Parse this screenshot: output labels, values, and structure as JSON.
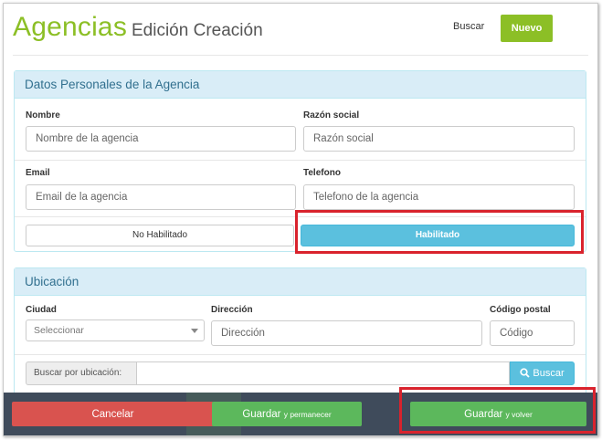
{
  "header": {
    "title": "Agencias",
    "subtitle": "Edición Creación",
    "buscar_label": "Buscar",
    "nuevo_label": "Nuevo"
  },
  "personal": {
    "heading": "Datos Personales de la Agencia",
    "nombre_label": "Nombre",
    "nombre_placeholder": "Nombre de la agencia",
    "razon_label": "Razón social",
    "razon_placeholder": "Razón social",
    "email_label": "Email",
    "email_placeholder": "Email de la agencia",
    "telefono_label": "Telefono",
    "telefono_placeholder": "Telefono de la agencia",
    "toggle_off_label": "No Habilitado",
    "toggle_on_label": "Habilitado",
    "selected_state": "Habilitado"
  },
  "ubicacion": {
    "heading": "Ubicación",
    "ciudad_label": "Ciudad",
    "ciudad_value": "Seleccionar",
    "direccion_label": "Dirección",
    "direccion_placeholder": "Dirección",
    "codigo_label": "Código postal",
    "codigo_placeholder": "Código",
    "search_addon": "Buscar por ubicación:",
    "search_button": "Buscar"
  },
  "actions": {
    "cancel_label": "Cancelar",
    "stay_label": "Guardar",
    "stay_suffix": "y permanecer",
    "back_label": "Guardar",
    "back_suffix": "y volver"
  },
  "colors": {
    "brand_green": "#8cbf26",
    "info_blue": "#5bc0de",
    "danger_red": "#d9534f",
    "success_green": "#5cb85c",
    "highlight_red": "#d9232d"
  },
  "icons": {
    "search_button_icon": "search-icon",
    "select_caret": "chevron-down-icon"
  }
}
